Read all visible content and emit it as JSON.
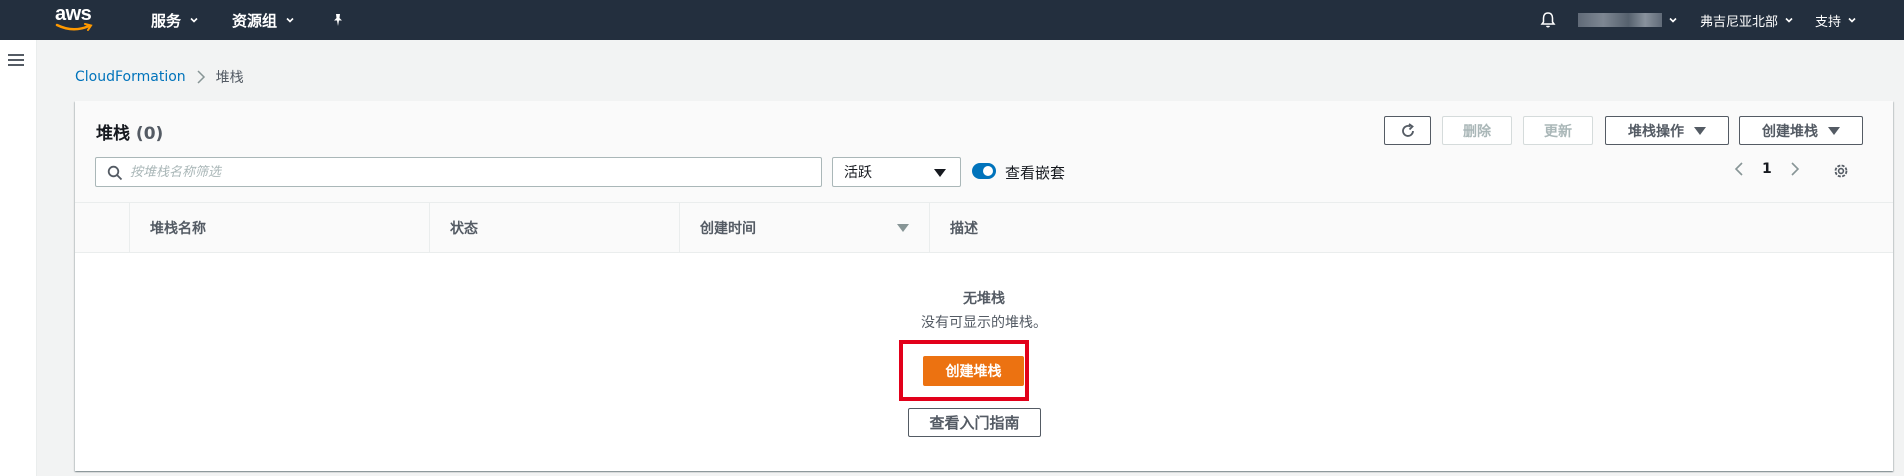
{
  "topnav": {
    "logo_text": "aws",
    "services_label": "服务",
    "resource_groups_label": "资源组",
    "pin_icon": "pin-icon",
    "bell_icon": "bell-icon",
    "region_label": "弗吉尼亚北部",
    "support_label": "支持"
  },
  "breadcrumb": {
    "root": "CloudFormation",
    "current": "堆栈"
  },
  "panel": {
    "title": "堆栈",
    "count": "(0)",
    "refresh_icon": "refresh-icon",
    "delete_label": "删除",
    "update_label": "更新",
    "stack_actions_label": "堆栈操作",
    "create_stack_label": "创建堆栈",
    "search_placeholder": "按堆栈名称筛选",
    "status_filter_value": "活跃",
    "nested_toggle_label": "查看嵌套",
    "nested_toggle_on": true,
    "page_number": "1"
  },
  "table": {
    "columns": [
      "堆栈名称",
      "状态",
      "创建时间",
      "描述"
    ]
  },
  "empty_state": {
    "title": "无堆栈",
    "subtitle": "没有可显示的堆栈。",
    "create_button_label": "创建堆栈",
    "guide_button_label": "查看入门指南"
  },
  "colors": {
    "nav_bg": "#232f3e",
    "primary": "#ec7211",
    "link": "#0073bb",
    "highlight": "#e2001a"
  }
}
